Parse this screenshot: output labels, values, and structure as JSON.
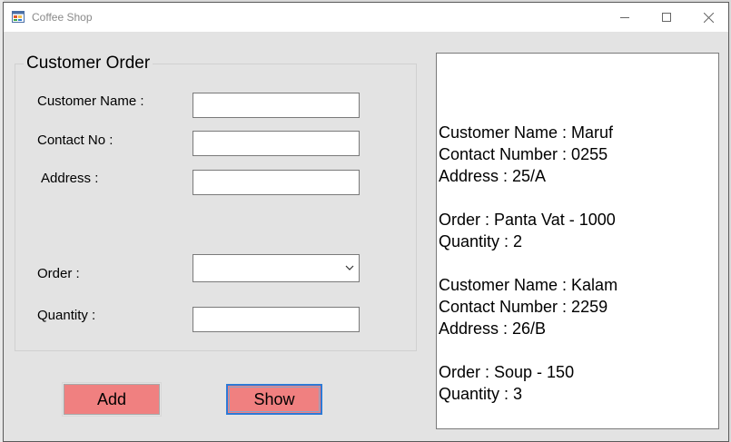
{
  "window": {
    "title": "Coffee Shop"
  },
  "form": {
    "group_title": "Customer Order",
    "fields": {
      "customer_name_label": "Customer Name :",
      "customer_name_value": "",
      "contact_label": "Contact No :",
      "contact_value": "",
      "address_label": "Address :",
      "address_value": "",
      "order_label": "Order :",
      "order_value": "",
      "quantity_label": "Quantity :",
      "quantity_value": ""
    }
  },
  "buttons": {
    "add_label": "Add",
    "show_label": "Show"
  },
  "output": {
    "lines": [
      "",
      "Customer Name : Maruf",
      "Contact Number : 0255",
      "Address : 25/A",
      "",
      "Order : Panta Vat - 1000",
      "Quantity : 2",
      "",
      "Customer Name : Kalam",
      "Contact Number : 2259",
      "Address : 26/B",
      "",
      "Order : Soup - 150",
      "Quantity : 3"
    ]
  },
  "colors": {
    "button_fill": "#f08080",
    "focus_border": "#2d7ad6",
    "window_bg": "#e3e3e3"
  },
  "icons": {
    "app": "app-window-icon",
    "minimize": "minimize-icon",
    "maximize": "maximize-icon",
    "close": "close-icon",
    "dropdown": "chevron-down-icon"
  }
}
